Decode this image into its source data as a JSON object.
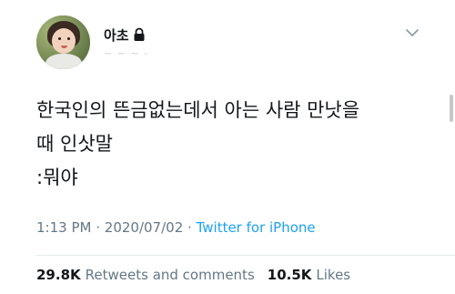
{
  "user": {
    "display_name": "아초",
    "handle": "~ ~ ~ -"
  },
  "tweet": {
    "lines": [
      "한국인의 뜬금없는데서 아는 사람 만낫을",
      "때 인삿말",
      ":뭐야"
    ],
    "time": "1:13 PM",
    "separator": "·",
    "date": "2020/07/02",
    "source": "Twitter for iPhone"
  },
  "stats": {
    "retweets_count": "29.8K",
    "retweets_label": "Retweets and comments",
    "likes_count": "10.5K",
    "likes_label": "Likes"
  },
  "icons": {
    "protected": "lock-icon",
    "menu": "chevron-down-icon"
  },
  "colors": {
    "link": "#1da1f2",
    "secondary_text": "#657786"
  }
}
